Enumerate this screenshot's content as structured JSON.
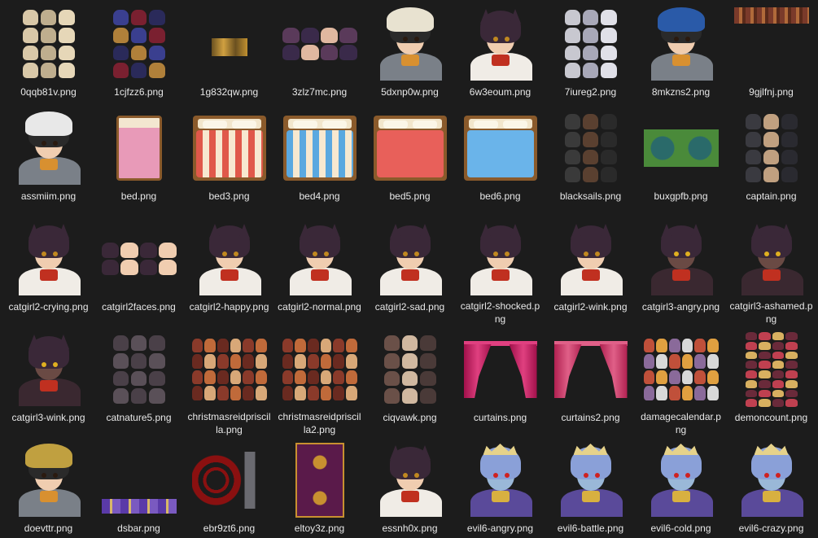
{
  "files": [
    {
      "name": "0qqb81v.png",
      "kind": "sheet-a"
    },
    {
      "name": "1cjfzz6.png",
      "kind": "sheet-b"
    },
    {
      "name": "1g832qw.png",
      "kind": "tiny-strip"
    },
    {
      "name": "3zlz7mc.png",
      "kind": "faces-dark"
    },
    {
      "name": "5dxnp0w.png",
      "kind": "portrait-knight"
    },
    {
      "name": "6w3eoum.png",
      "kind": "portrait-catgirl"
    },
    {
      "name": "7iureg2.png",
      "kind": "sheet-silver"
    },
    {
      "name": "8mkzns2.png",
      "kind": "portrait-knight-blue"
    },
    {
      "name": "9gjlfnj.png",
      "kind": "wide-strip"
    },
    {
      "name": "assmiim.png",
      "kind": "portrait-knight-white"
    },
    {
      "name": "bed.png",
      "kind": "bed-small"
    },
    {
      "name": "bed3.png",
      "kind": "bed-red-stripe"
    },
    {
      "name": "bed4.png",
      "kind": "bed-blue-stripe"
    },
    {
      "name": "bed5.png",
      "kind": "bed-red"
    },
    {
      "name": "bed6.png",
      "kind": "bed-blue"
    },
    {
      "name": "blacksails.png",
      "kind": "sheet-dark"
    },
    {
      "name": "buxgpfb.png",
      "kind": "tile-green"
    },
    {
      "name": "captain.png",
      "kind": "sheet-captain"
    },
    {
      "name": "catgirl2-crying.png",
      "kind": "portrait-catgirl"
    },
    {
      "name": "catgirl2faces.png",
      "kind": "faces-catgirl"
    },
    {
      "name": "catgirl2-happy.png",
      "kind": "portrait-catgirl"
    },
    {
      "name": "catgirl2-normal.png",
      "kind": "portrait-catgirl"
    },
    {
      "name": "catgirl2-sad.png",
      "kind": "portrait-catgirl"
    },
    {
      "name": "catgirl2-shocked.png",
      "kind": "portrait-catgirl"
    },
    {
      "name": "catgirl2-wink.png",
      "kind": "portrait-catgirl"
    },
    {
      "name": "catgirl3-angry.png",
      "kind": "portrait-catgirl-dark"
    },
    {
      "name": "catgirl3-ashamed.png",
      "kind": "portrait-catgirl-dark"
    },
    {
      "name": "catgirl3-wink.png",
      "kind": "portrait-catgirl-dark"
    },
    {
      "name": "catnature5.png",
      "kind": "sheet-cats"
    },
    {
      "name": "christmasreidpriscilla.png",
      "kind": "sheet-xmas"
    },
    {
      "name": "christmasreidpriscilla2.png",
      "kind": "sheet-xmas"
    },
    {
      "name": "ciqvawk.png",
      "kind": "sheet-ciq"
    },
    {
      "name": "curtains.png",
      "kind": "curtain"
    },
    {
      "name": "curtains2.png",
      "kind": "curtain2"
    },
    {
      "name": "damagecalendar.png",
      "kind": "sheet-damage"
    },
    {
      "name": "demoncount.png",
      "kind": "sheet-demon"
    },
    {
      "name": "doevttr.png",
      "kind": "portrait-knight-gold"
    },
    {
      "name": "dsbar.png",
      "kind": "dsbar"
    },
    {
      "name": "ebr9zt6.png",
      "kind": "magic-circle"
    },
    {
      "name": "eltoy3z.png",
      "kind": "carpet"
    },
    {
      "name": "essnh0x.png",
      "kind": "portrait-catgirl"
    },
    {
      "name": "evil6-angry.png",
      "kind": "portrait-evil"
    },
    {
      "name": "evil6-battle.png",
      "kind": "portrait-evil"
    },
    {
      "name": "evil6-cold.png",
      "kind": "portrait-evil"
    },
    {
      "name": "evil6-crazy.png",
      "kind": "portrait-evil"
    }
  ],
  "labels": {
    "0": "0qqb81v.png",
    "1": "1cjfzz6.png",
    "2": "1g832qw.png",
    "3": "3zlz7mc.png",
    "4": "5dxnp0w.png",
    "5": "6w3eoum.png",
    "6": "7iureg2.png",
    "7": "8mkzns2.png",
    "8": "9gjlfnj.png",
    "9": "assmiim.png",
    "10": "bed.png",
    "11": "bed3.png",
    "12": "bed4.png",
    "13": "bed5.png",
    "14": "bed6.png",
    "15": "blacksails.png",
    "16": "buxgpfb.png",
    "17": "captain.png",
    "18": "catgirl2-crying.png",
    "19": "catgirl2faces.png",
    "20": "catgirl2-happy.png",
    "21": "catgirl2-normal.png",
    "22": "catgirl2-sad.png",
    "23": "catgirl2-shocked.png",
    "24": "catgirl2-wink.png",
    "25": "catgirl3-angry.png",
    "26": "catgirl3-ashamed.png",
    "27": "catgirl3-wink.png",
    "28": "catnature5.png",
    "29": "christmasreidpriscilla.png",
    "30": "christmasreidpriscilla2.png",
    "31": "ciqvawk.png",
    "32": "curtains.png",
    "33": "curtains2.png",
    "34": "damagecalendar.png",
    "35": "demoncount.png",
    "36": "doevttr.png",
    "37": "dsbar.png",
    "38": "ebr9zt6.png",
    "39": "eltoy3z.png",
    "40": "essnh0x.png",
    "41": "evil6-angry.png",
    "42": "evil6-battle.png",
    "43": "evil6-cold.png",
    "44": "evil6-crazy.png"
  },
  "colors": {
    "background": "#1c1c1c",
    "text": "#e8e8e8",
    "selection": "#2f4f6f"
  }
}
